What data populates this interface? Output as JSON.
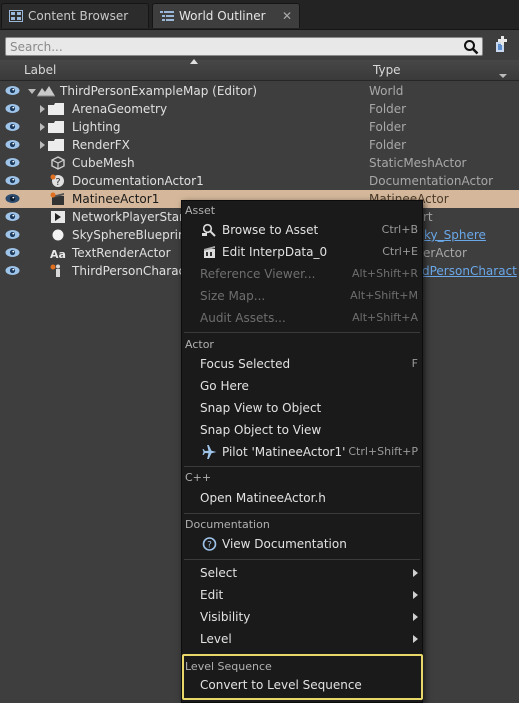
{
  "tabs": [
    {
      "label": "Content Browser",
      "icon": "content-browser-icon"
    },
    {
      "label": "World Outliner",
      "icon": "world-outliner-icon"
    }
  ],
  "search": {
    "placeholder": "Search..."
  },
  "columns": {
    "label": "Label",
    "type": "Type"
  },
  "tree": [
    {
      "label": "ThirdPersonExampleMap (Editor)",
      "type": "World",
      "icon": "world-icon",
      "expanded": true
    },
    {
      "label": "ArenaGeometry",
      "type": "Folder",
      "icon": "folder-icon"
    },
    {
      "label": "Lighting",
      "type": "Folder",
      "icon": "folder-icon"
    },
    {
      "label": "RenderFX",
      "type": "Folder",
      "icon": "folder-icon"
    },
    {
      "label": "CubeMesh",
      "type": "StaticMeshActor",
      "icon": "static-mesh-icon"
    },
    {
      "label": "DocumentationActor1",
      "type": "DocumentationActor",
      "icon": "documentation-actor-icon"
    },
    {
      "label": "MatineeActor1",
      "type": "MatineeActor",
      "icon": "matinee-icon",
      "selected": true
    },
    {
      "label": "NetworkPlayerStart",
      "type": "rt",
      "icon": "player-start-icon"
    },
    {
      "label": "SkySphereBlueprint",
      "type": "ky_Sphere",
      "icon": "sky-sphere-icon",
      "link": true
    },
    {
      "label": "TextRenderActor",
      "type": "erActor",
      "icon": "text-render-icon"
    },
    {
      "label": "ThirdPersonCharact",
      "type": "dPersonCharact",
      "icon": "character-icon",
      "link": true
    }
  ],
  "menu": {
    "sections": {
      "asset": "Asset",
      "actor": "Actor",
      "cpp": "C++",
      "documentation": "Documentation",
      "level_sequence": "Level Sequence"
    },
    "asset_items": [
      {
        "label": "Browse to Asset",
        "shortcut": "Ctrl+B",
        "icon": "browse-icon"
      },
      {
        "label": "Edit InterpData_0",
        "shortcut": "Ctrl+E",
        "icon": "edit-interp-icon"
      },
      {
        "label": "Reference Viewer...",
        "shortcut": "Alt+Shift+R",
        "disabled": true
      },
      {
        "label": "Size Map...",
        "shortcut": "Alt+Shift+M",
        "disabled": true
      },
      {
        "label": "Audit Assets...",
        "shortcut": "Alt+Shift+A",
        "disabled": true
      }
    ],
    "actor_items": [
      {
        "label": "Focus Selected",
        "shortcut": "F"
      },
      {
        "label": "Go Here"
      },
      {
        "label": "Snap View to Object"
      },
      {
        "label": "Snap Object to View"
      },
      {
        "label": "Pilot 'MatineeActor1'",
        "shortcut": "Ctrl+Shift+P",
        "icon": "airplane-icon"
      }
    ],
    "cpp_items": [
      {
        "label": "Open MatineeActor.h"
      }
    ],
    "documentation_items": [
      {
        "label": "View Documentation",
        "icon": "help-icon"
      }
    ],
    "submenus": [
      {
        "label": "Select"
      },
      {
        "label": "Edit"
      },
      {
        "label": "Visibility"
      },
      {
        "label": "Level"
      }
    ],
    "level_sequence_items": [
      {
        "label": "Convert to Level Sequence"
      }
    ]
  },
  "colors": {
    "selected_row": "#d5b89b",
    "highlight_border": "#e8d86a",
    "link": "#6aa8ea"
  }
}
